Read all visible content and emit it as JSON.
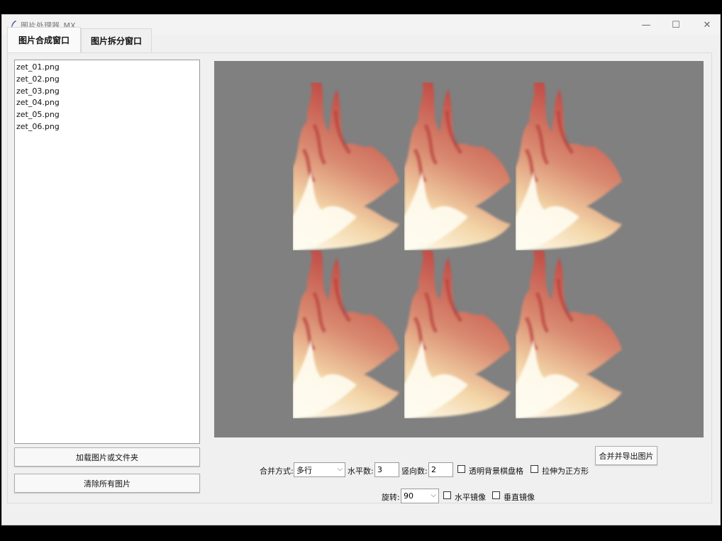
{
  "window": {
    "title": "图片处理器_MX",
    "min_glyph": "—",
    "max_glyph": "☐",
    "close_glyph": "✕"
  },
  "tabs": [
    {
      "label": "图片合成窗口",
      "active": true
    },
    {
      "label": "图片拆分窗口",
      "active": false
    }
  ],
  "file_list": [
    "zet_01.png",
    "zet_02.png",
    "zet_03.png",
    "zet_04.png",
    "zet_05.png",
    "zet_06.png"
  ],
  "buttons": {
    "load": "加载图片或文件夹",
    "clear": "清除所有图片",
    "merge_export": "合并并导出图片"
  },
  "controls": {
    "merge_mode_label": "合并方式:",
    "merge_mode_value": "多行",
    "h_count_label": "水平数:",
    "h_count_value": "3",
    "v_count_label": "竖向数:",
    "v_count_value": "2",
    "transparent_checker_label": "透明背景棋盘格",
    "stretch_square_label": "拉伸为正方形",
    "rotate_label": "旋转:",
    "rotate_value": "90",
    "h_mirror_label": "水平镜像",
    "v_mirror_label": "垂直镜像",
    "arrow_glyph": "⌵"
  },
  "preview": {
    "background": "#808080",
    "grid_cols": 3,
    "grid_rows": 2
  }
}
